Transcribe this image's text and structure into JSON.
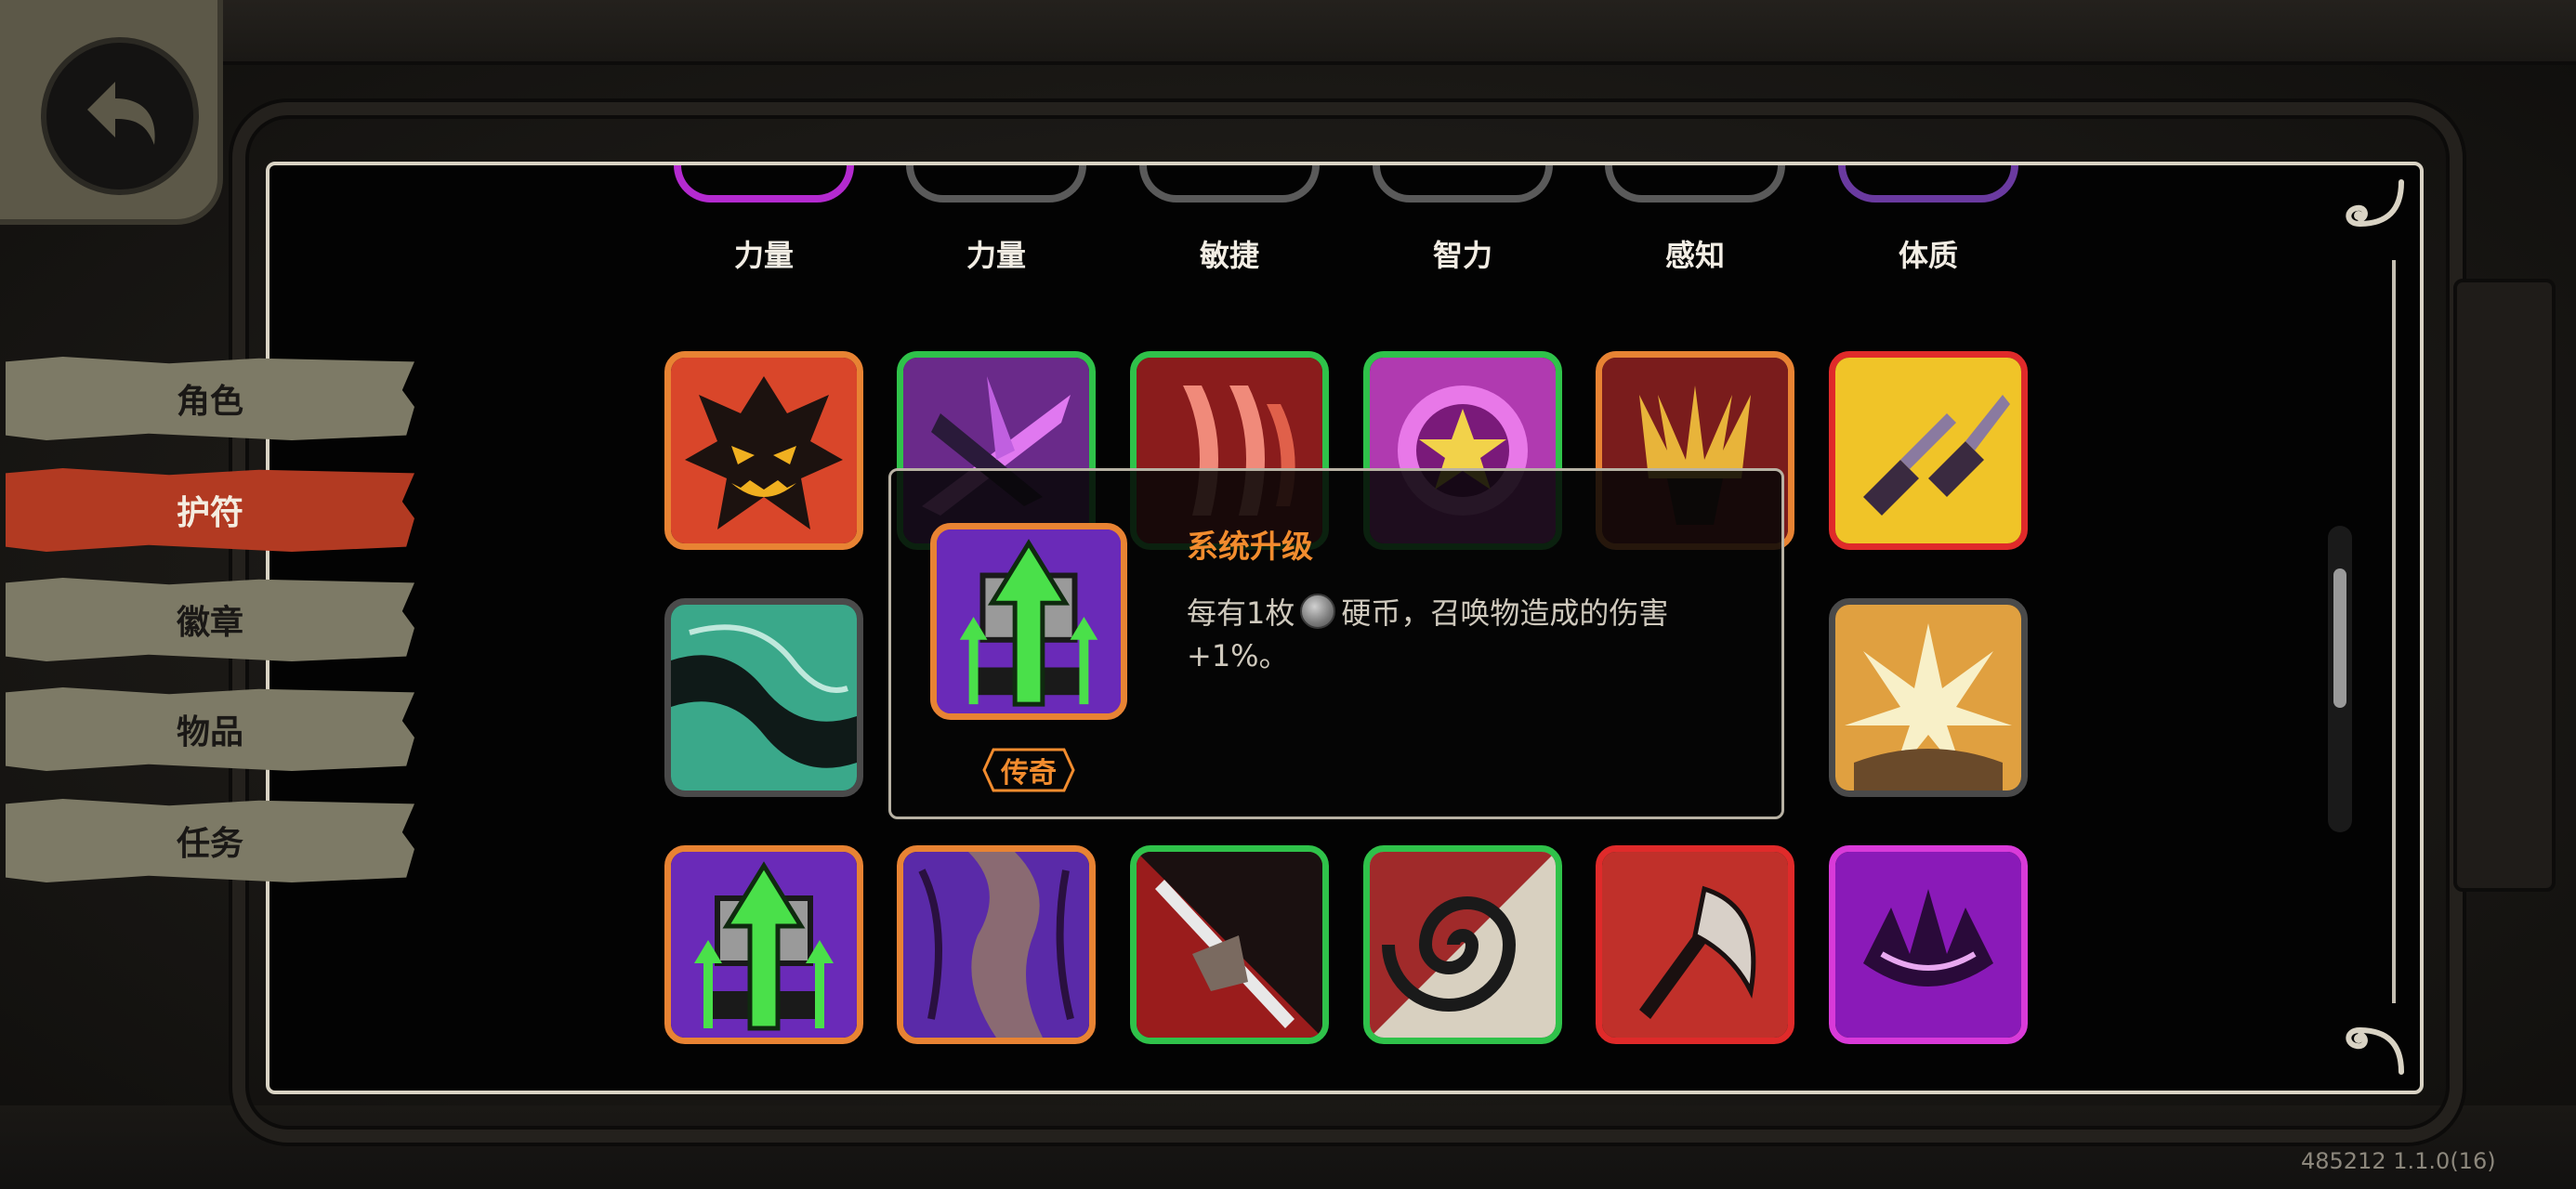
{
  "navigation": {
    "tabs": [
      {
        "label": "角色",
        "active": false
      },
      {
        "label": "护符",
        "active": true
      },
      {
        "label": "徽章",
        "active": false
      },
      {
        "label": "物品",
        "active": false
      },
      {
        "label": "任务",
        "active": false
      }
    ]
  },
  "stat_labels": [
    "力量",
    "力量",
    "敏捷",
    "智力",
    "感知",
    "体质"
  ],
  "relic_grid": {
    "row1": [
      {
        "icon": "demon-face-icon",
        "rarity_color": "#e88333"
      },
      {
        "icon": "purple-slash-icon",
        "rarity_color": "#2fc24a"
      },
      {
        "icon": "red-claw-icon",
        "rarity_color": "#2fc24a"
      },
      {
        "icon": "arcane-star-icon",
        "rarity_color": "#2fc24a"
      },
      {
        "icon": "golden-helm-icon",
        "rarity_color": "#e88333"
      },
      {
        "icon": "twin-blades-icon",
        "rarity_color": "#e02a2a"
      }
    ],
    "row2": [
      {
        "icon": "teal-wave-icon",
        "rarity_color": "#4a4a4a"
      },
      {
        "icon": "golden-burst-icon",
        "rarity_color": "#4a4a4a"
      }
    ],
    "row3": [
      {
        "icon": "system-upgrade-icon",
        "rarity_color": "#e88333"
      },
      {
        "icon": "purple-rift-icon",
        "rarity_color": "#e88333"
      },
      {
        "icon": "spear-strike-icon",
        "rarity_color": "#2fc24a"
      },
      {
        "icon": "spiral-vortex-icon",
        "rarity_color": "#2fc24a"
      },
      {
        "icon": "battle-axe-icon",
        "rarity_color": "#e02a2a"
      },
      {
        "icon": "dark-crown-icon",
        "rarity_color": "#d93ad9"
      }
    ]
  },
  "tooltip": {
    "title": "系统升级",
    "description_before_coin": "每有1枚",
    "description_after_coin": "硬币，召唤物造成的伤害+1%。",
    "rarity": "传奇",
    "icon": "system-upgrade-icon",
    "title_color": "#f28c2e"
  },
  "footer": {
    "version": "485212 1.1.0(16)"
  },
  "colors": {
    "active_tab": "#b23a22",
    "inactive_tab": "#7d7a66",
    "legendary": "#e88333",
    "rare_green": "#2fc24a",
    "epic_red": "#e02a2a",
    "mythic_magenta": "#d93ad9"
  }
}
